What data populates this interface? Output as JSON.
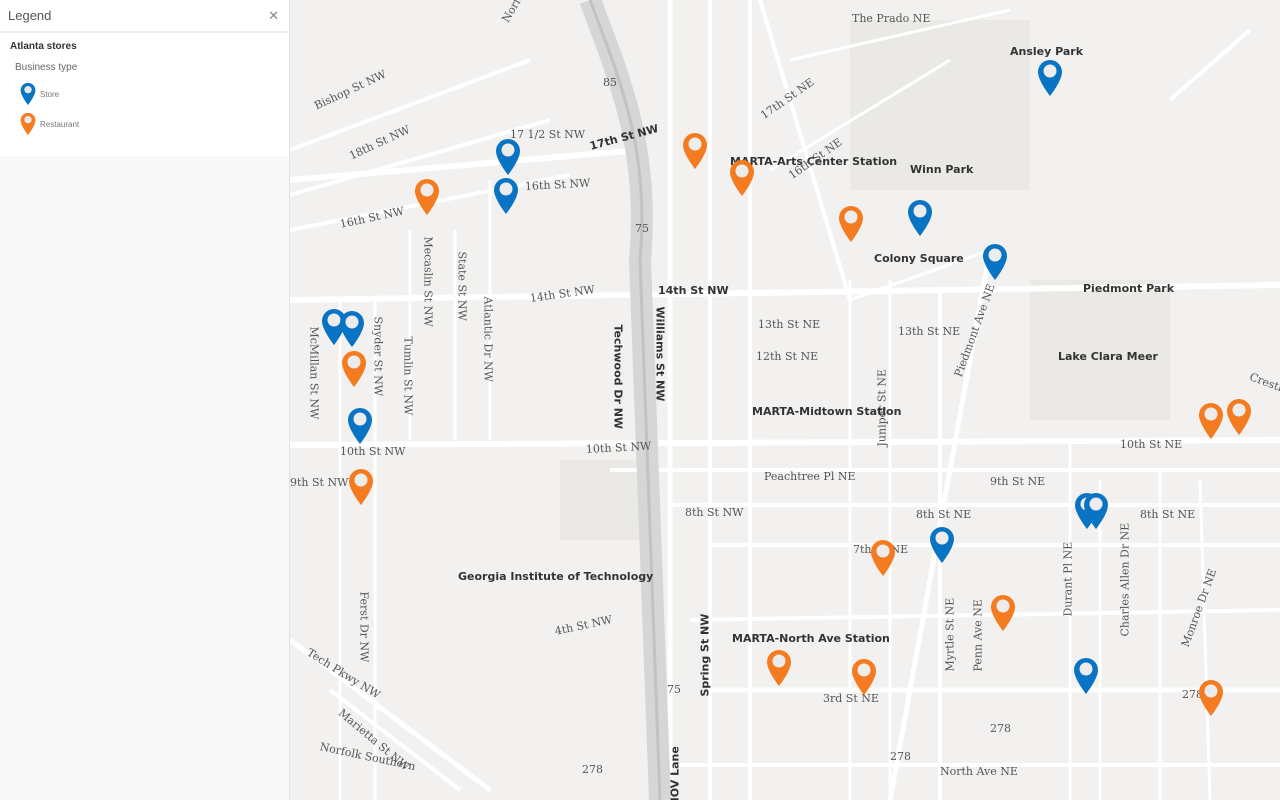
{
  "legend": {
    "title": "Legend",
    "close_icon": "close-icon",
    "layer_title": "Atlanta stores",
    "group_title": "Business type",
    "items": [
      {
        "label": "Store",
        "color": "#0a74c4",
        "icon": "map-pin-icon"
      },
      {
        "label": "Restaurant",
        "color": "#f47b20",
        "icon": "map-pin-icon"
      }
    ]
  },
  "map": {
    "labels": [
      "17th St NW",
      "16th St NW",
      "16th St NW",
      "17 1/2 St NW",
      "14th St NW",
      "14th St NW",
      "10th St NW",
      "10th St NW",
      "9th St NW",
      "8th St NW",
      "4th St NW",
      "Williams St NW",
      "Techwood Dr NW",
      "Spring St NW",
      "13th St NE",
      "12th St NE",
      "13th St NE",
      "Peachtree Pl NE",
      "9th St NE",
      "8th St NE",
      "8th St NE",
      "7th St NE",
      "3rd St NE",
      "North Ave NE",
      "10th St NE",
      "Piedmont Ave NE",
      "Juniper St NE",
      "Myrtle St NE",
      "Penn Ave NE",
      "Durant Pl NE",
      "Charles Allen Dr NE",
      "Monroe Dr NE",
      "Ansley Park",
      "Winn Park",
      "Colony Square",
      "Piedmont Park",
      "Lake Clara Meer",
      "Georgia Institute of Technology",
      "MARTA-Midtown Station",
      "MARTA-North Ave Station",
      "MARTA-Arts Center Station",
      "The Prado NE",
      "17th St NE",
      "16th St NE",
      "Bishop St NW",
      "18th St NW",
      "Mecaslin St NW",
      "State St NW",
      "Atlantic Dr NW",
      "Tumlin St NW",
      "Snyder St NW",
      "McMillan St NW",
      "Ferst Dr NW",
      "Tech Pkwy NW",
      "Marietta St NW",
      "Norfolk Southern",
      "Norfolk",
      "Crestline",
      "HOV Lane",
      "85",
      "75",
      "75",
      "278",
      "278",
      "278",
      "278"
    ],
    "pin_colors": {
      "store": "#0a74c4",
      "restaurant": "#f47b20"
    }
  }
}
